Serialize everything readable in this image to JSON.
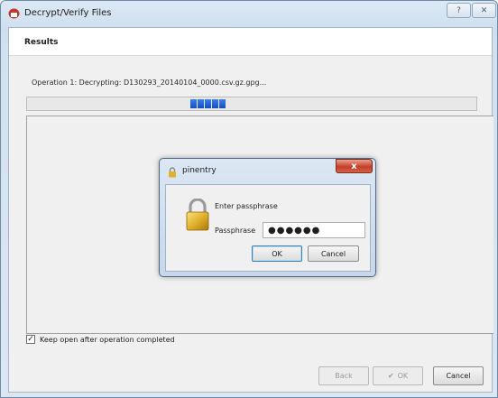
{
  "window": {
    "title": "Decrypt/Verify Files",
    "help_glyph": "?",
    "close_glyph": "✕"
  },
  "page": {
    "title": "Results",
    "operation_label": "Operation 1: Decrypting: D130293_20140104_0000.csv.gz.gpg...",
    "progress_chunks": 5
  },
  "keep_open": {
    "label": "Keep open after operation completed",
    "checked": true,
    "check_glyph": "✓"
  },
  "buttons": {
    "back": "Back",
    "ok": "OK",
    "cancel": "Cancel",
    "ok_icon_glyph": "✔"
  },
  "pinentry": {
    "title": "pinentry",
    "close_glyph": "x",
    "prompt": "Enter passphrase",
    "field_label": "Passphrase",
    "field_value": "●●●●●●",
    "ok": "OK",
    "cancel": "Cancel"
  },
  "colors": {
    "progress": "#2a66d6",
    "close_red": "#c4402b",
    "lock_gold": "#e2b12c"
  }
}
